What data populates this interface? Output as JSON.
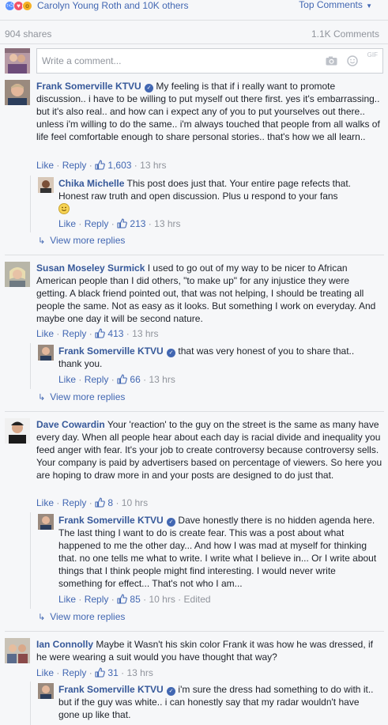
{
  "reactions_bar": {
    "icons": [
      "like-icon",
      "love-icon",
      "wow-icon"
    ],
    "reactors_text": "Carolyn Young Roth and 10K others",
    "sort_label": "Top Comments"
  },
  "stats": {
    "shares": "904 shares",
    "comments": "1.1K Comments"
  },
  "composer": {
    "placeholder": "Write a comment...",
    "gif_label": "GIF"
  },
  "labels": {
    "like": "Like",
    "reply": "Reply",
    "dot": "·",
    "view_more_replies": "View more replies"
  },
  "comments": [
    {
      "author": "Frank Somerville KTVU",
      "verified": true,
      "text": "My feeling is that if i really want to promote discussion.. i have to be willing to put myself out there first. yes it's embarrassing.. but it's also real.. and how can i expect any of you to put yourselves out there.. unless i'm willing to do the same.. i'm always touched that people from all walks of life feel comfortable enough to share personal stories.. that's how we all learn..",
      "likes": "1,603",
      "time": "13 hrs",
      "reply": {
        "author": "Chika Michelle",
        "verified": false,
        "text": "This post does just that. Your entire page refects that. Honest raw truth and open discussion. Plus u respond to your fans",
        "likes": "213",
        "time": "13 hrs"
      }
    },
    {
      "author": "Susan Moseley Surmick",
      "verified": false,
      "text": "I used to go out of my way to be nicer to African American people than I did others, \"to make up\" for any injustice they were getting. A black friend pointed out, that was not helping, I should be treating all people the same. Not as easy as it looks. But something I work on everyday. And maybe one day it will be second nature.",
      "likes": "413",
      "time": "13 hrs",
      "reply": {
        "author": "Frank Somerville KTVU",
        "verified": true,
        "text": "that was very honest of you to share that.. thank you.",
        "likes": "66",
        "time": "13 hrs"
      }
    },
    {
      "author": "Dave Cowardin",
      "verified": false,
      "text": "Your 'reaction' to the guy on the street is the same as many have every day. When all people hear about each day is racial divide and inequality you feed anger with fear. It's your job to create controversy because controversy sells. Your company is paid by advertisers based on percentage of viewers. So here you are hoping to draw more in and your posts are designed to do just that.",
      "likes": "8",
      "time": "10 hrs",
      "reply": {
        "author": "Frank Somerville KTVU",
        "verified": true,
        "text": "Dave honestly there is no hidden agenda here. The last thing I want to do is create fear. This was a post about what happened to me the other day... And how I was mad at myself for thinking that. no one tells me what to write. I write what I believe in... Or I write about things that I think people might find interesting. I would never write something for effect... That's not who I am...",
        "likes": "85",
        "time": "10 hrs",
        "edited": "Edited"
      }
    },
    {
      "author": "Ian Connolly",
      "verified": false,
      "text": "Maybe it Wasn't his skin color Frank it was how he was dressed, if he were wearing a suit would you have thought that way?",
      "likes": "31",
      "time": "13 hrs",
      "reply": {
        "author": "Frank Somerville KTVU",
        "verified": true,
        "text": "i'm sure the dress had something to do with it.. but if the guy was white.. i can honestly say that my radar wouldn't have gone up like that."
      }
    }
  ],
  "colors": {
    "link": "#4267b2",
    "author": "#365899",
    "meta": "#90949c",
    "text": "#1d2129",
    "background": "#f6f7f9"
  }
}
